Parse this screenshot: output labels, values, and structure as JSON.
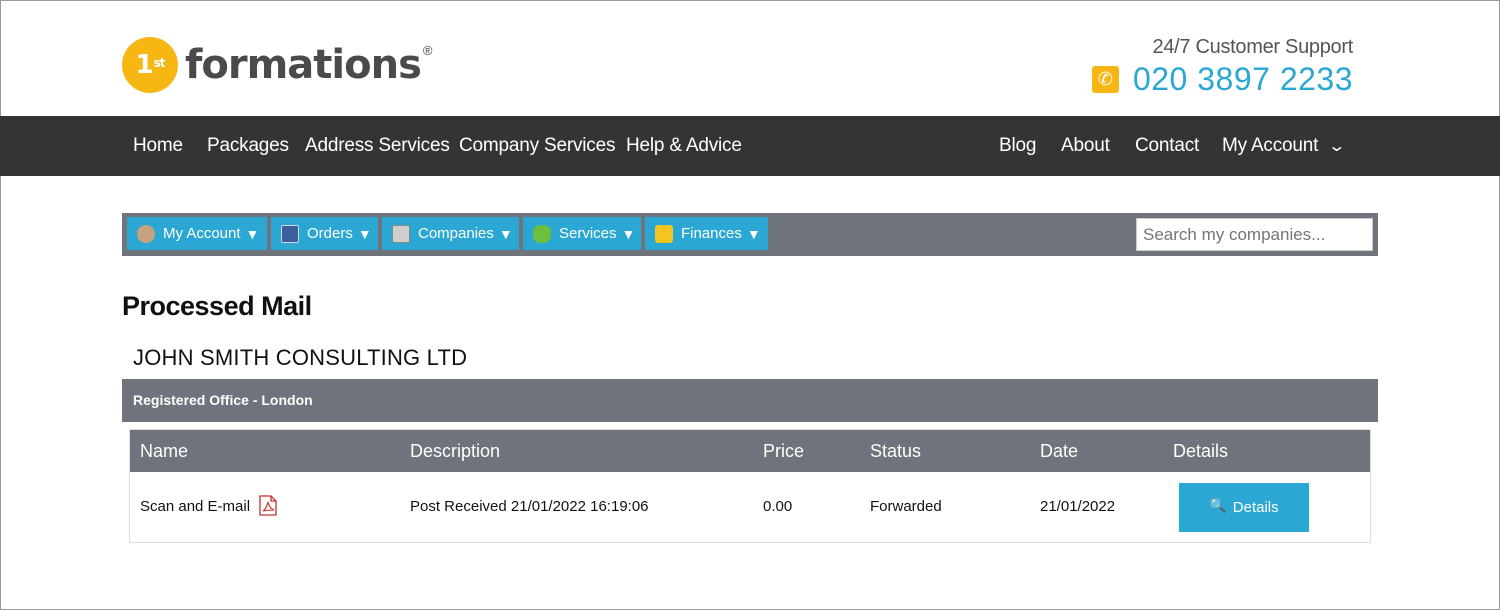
{
  "header": {
    "logo_badge": "1",
    "logo_badge_sup": "st",
    "logo_word": "formations",
    "logo_reg": "®",
    "support_label": "24/7 Customer Support",
    "phone_number": "020 3897 2233"
  },
  "nav": {
    "left": [
      "Home",
      "Packages",
      "Address Services",
      "Company Services",
      "Help & Advice"
    ],
    "right": [
      "Blog",
      "About",
      "Contact",
      "My Account"
    ]
  },
  "toolbar": {
    "buttons": [
      {
        "label": "My Account",
        "icon": "user-icon"
      },
      {
        "label": "Orders",
        "icon": "book-icon"
      },
      {
        "label": "Companies",
        "icon": "building-icon"
      },
      {
        "label": "Services",
        "icon": "puzzle-icon"
      },
      {
        "label": "Finances",
        "icon": "coins-icon"
      }
    ],
    "arrow": "▼",
    "search_placeholder": "Search my companies..."
  },
  "page": {
    "title": "Processed Mail",
    "company": "JOHN SMITH CONSULTING LTD",
    "section": "Registered Office - London"
  },
  "table": {
    "headers": [
      "Name",
      "Description",
      "Price",
      "Status",
      "Date",
      "Details"
    ],
    "rows": [
      {
        "name": "Scan and E-mail",
        "description": "Post Received 21/01/2022 16:19:06",
        "price": "0.00",
        "status": "Forwarded",
        "date": "21/01/2022",
        "details_label": "Details"
      }
    ]
  },
  "colors": {
    "brand_yellow": "#f6b714",
    "accent_blue": "#2aa7d2",
    "nav_bg": "#323436",
    "bar_grey": "#6e737c"
  }
}
